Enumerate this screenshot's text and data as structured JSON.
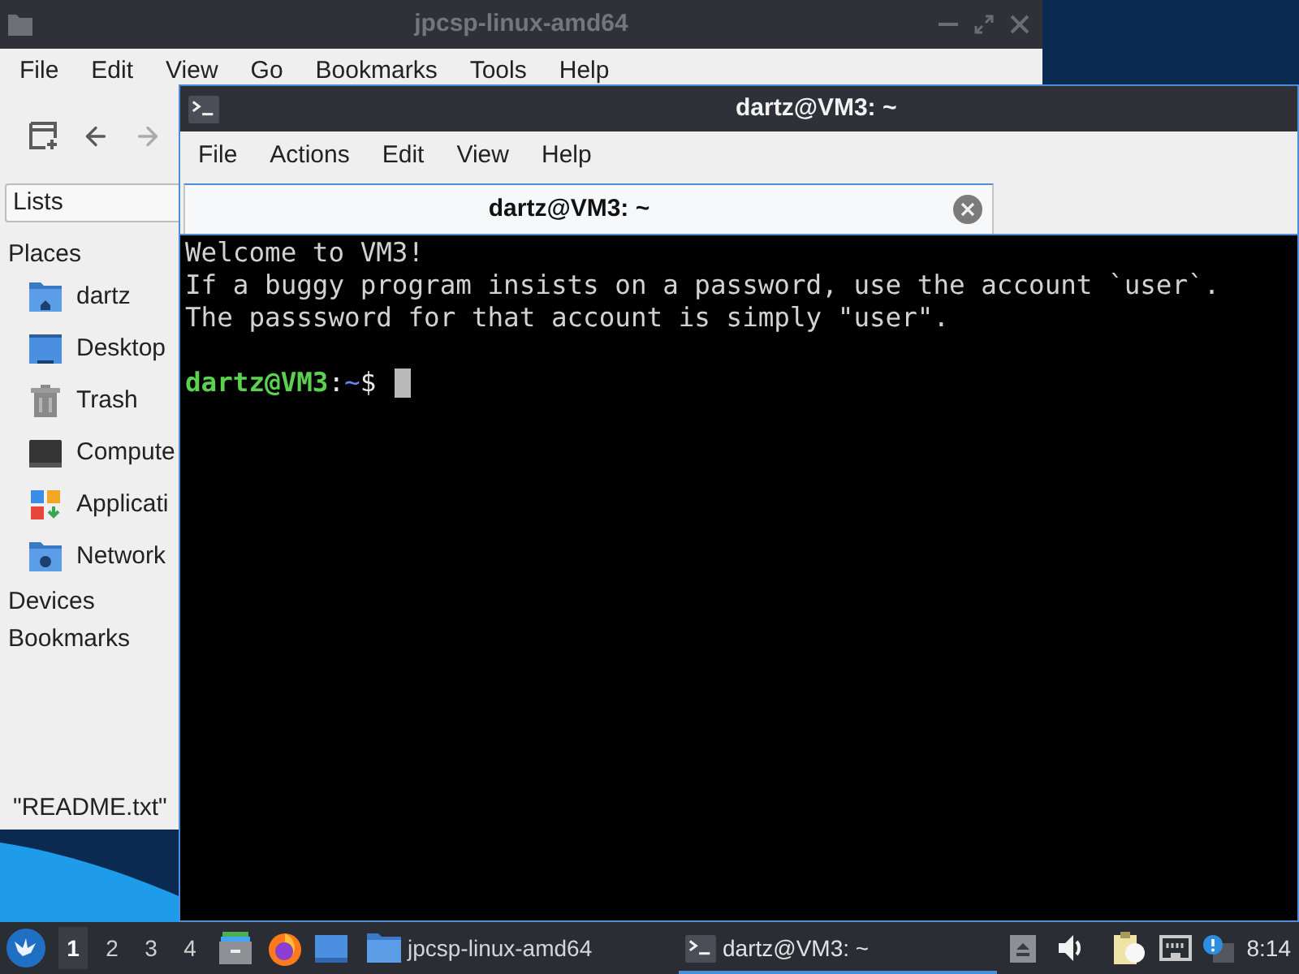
{
  "file_manager": {
    "title": "jpcsp-linux-amd64",
    "active": false,
    "menu": [
      "File",
      "Edit",
      "View",
      "Go",
      "Bookmarks",
      "Tools",
      "Help"
    ],
    "toolbar": [
      {
        "kind": "new_tab",
        "disabled": false
      },
      {
        "kind": "back",
        "disabled": false
      },
      {
        "kind": "forward",
        "disabled": true
      }
    ],
    "side_pane": {
      "view": "Lists",
      "sections": [
        {
          "title": "Places",
          "items": [
            {
              "label": "dartz",
              "kind": "home"
            },
            {
              "label": "Desktop",
              "kind": "desktop"
            },
            {
              "label": "Trash",
              "kind": "trash"
            },
            {
              "label": "Compute",
              "kind": "computer"
            },
            {
              "label": "Applicati",
              "kind": "applications"
            },
            {
              "label": "Network",
              "kind": "network"
            }
          ]
        },
        {
          "title": "Devices"
        },
        {
          "title": "Bookmarks"
        }
      ]
    },
    "status_text": "\"README.txt\""
  },
  "terminal": {
    "title": "dartz@VM3: ~",
    "active": true,
    "menu": [
      "File",
      "Actions",
      "Edit",
      "View",
      "Help"
    ],
    "tabs": [
      {
        "label": "dartz@VM3: ~",
        "selected": true
      }
    ],
    "lines": [
      "Welcome to VM3!",
      "If a buggy program insists on a password, use the account `user`.",
      "The passsword for that account is simply \"user\"."
    ],
    "prompt": {
      "user_host": "dartz@VM3",
      "separator": ":",
      "path": "~",
      "symbol": "$"
    }
  },
  "taskbar": {
    "workspaces": [
      {
        "label": "1",
        "selected": true
      },
      {
        "label": "2",
        "selected": false
      },
      {
        "label": "3",
        "selected": false
      },
      {
        "label": "4",
        "selected": false
      }
    ],
    "tasks": [
      {
        "label": "jpcsp-linux-amd64",
        "kind": "folder",
        "selected": false
      },
      {
        "label": "dartz@VM3: ~",
        "kind": "terminal",
        "selected": true
      }
    ],
    "clock": "8:14"
  }
}
